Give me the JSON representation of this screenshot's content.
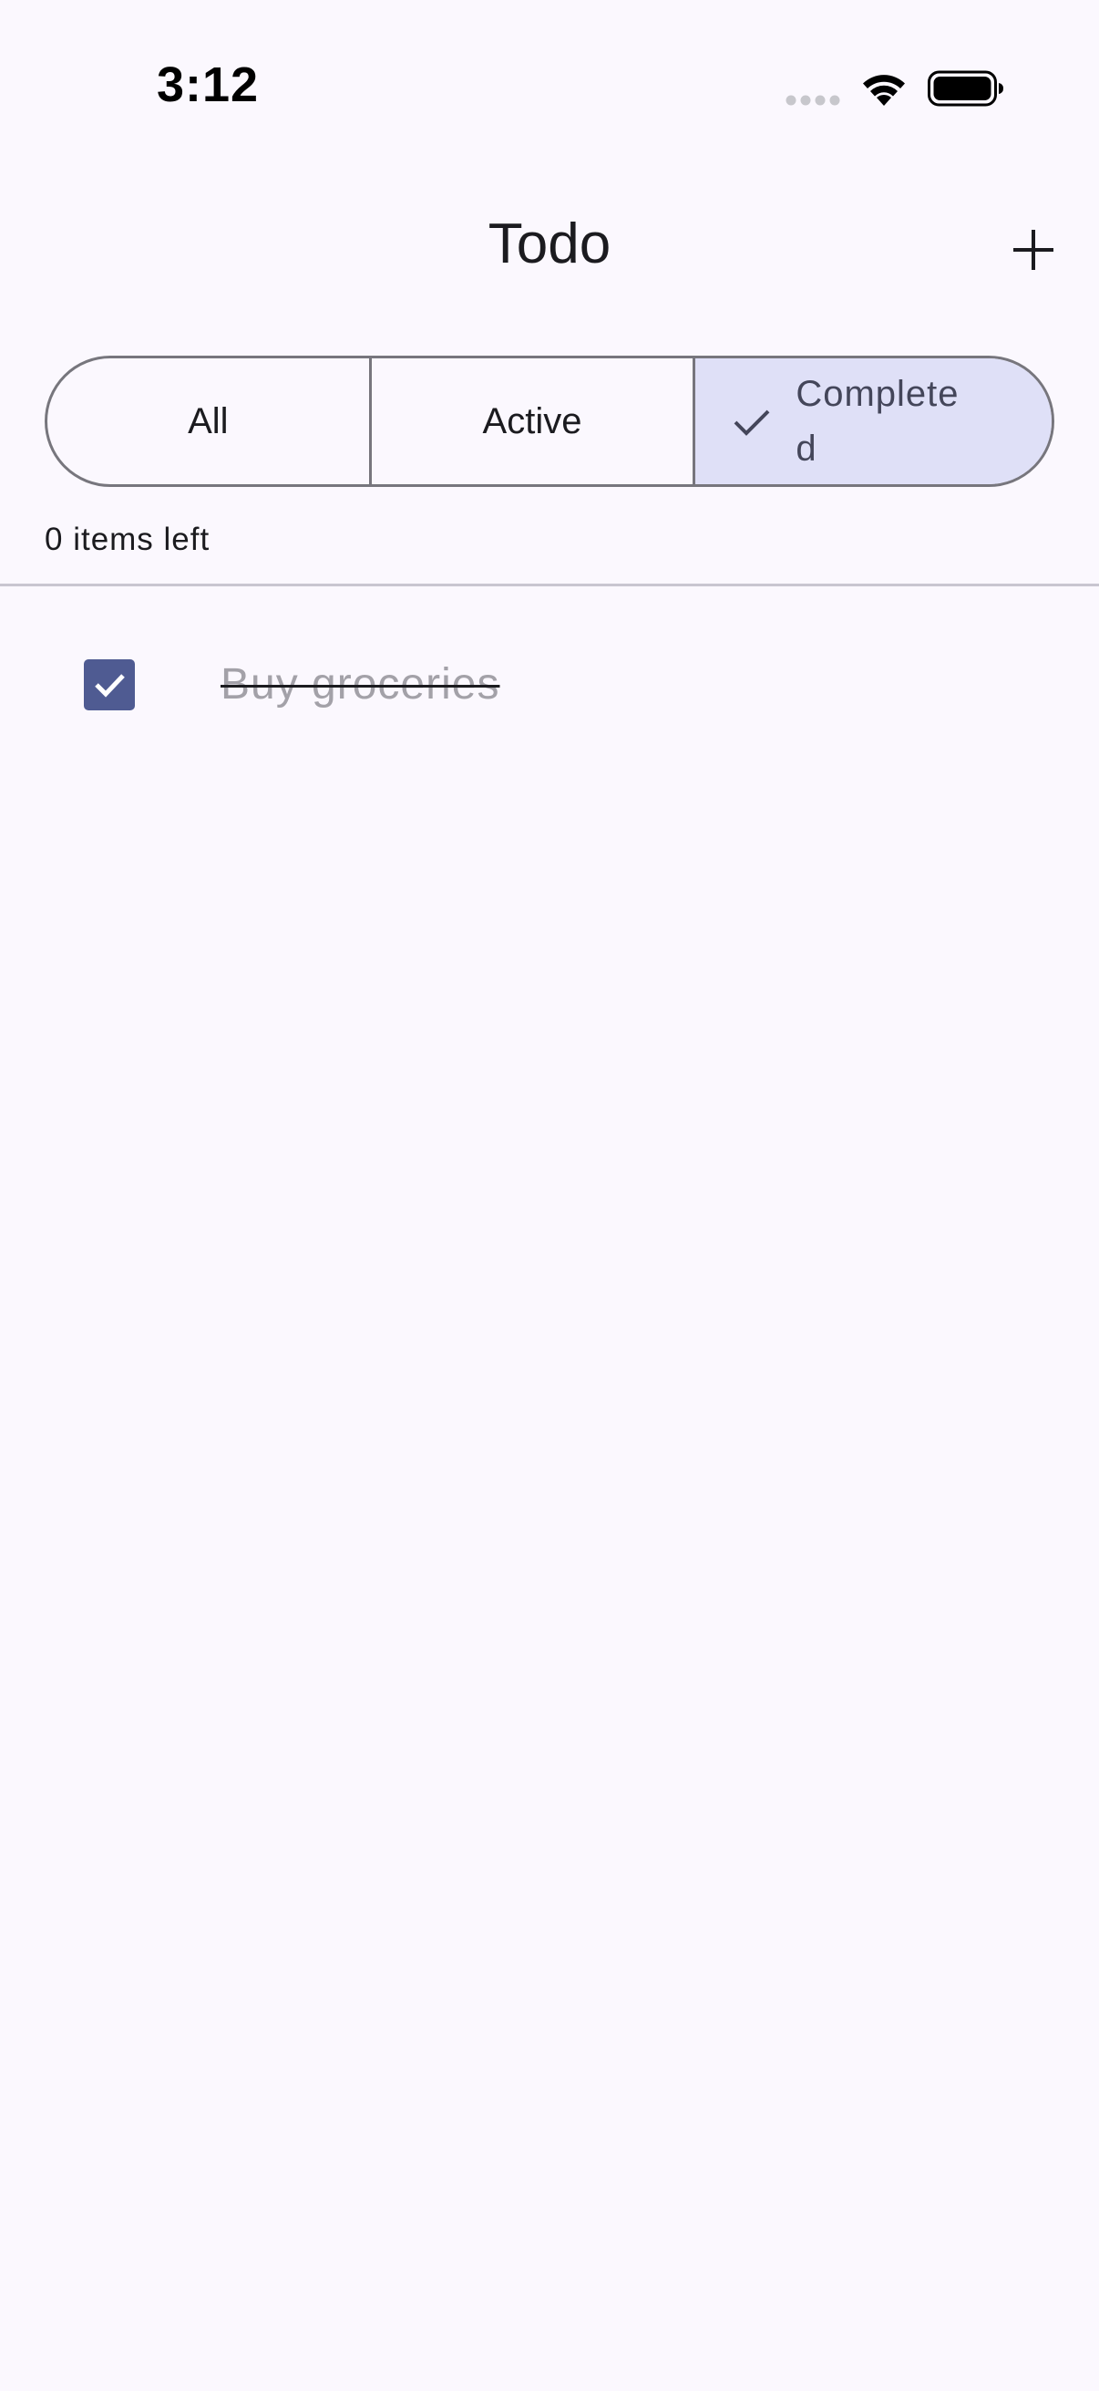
{
  "status_bar": {
    "time": "3:12",
    "icons": [
      "signal-dots-icon",
      "wifi-icon",
      "battery-icon"
    ]
  },
  "app_bar": {
    "title": "Todo",
    "add_icon": "plus-icon"
  },
  "filter": {
    "segments": [
      {
        "label": "All",
        "selected": false
      },
      {
        "label": "Active",
        "selected": false
      },
      {
        "label": "Completed",
        "selected": true
      }
    ],
    "selected_icon": "check-icon"
  },
  "summary": {
    "items_left": "0 items left"
  },
  "todos": [
    {
      "text": "Buy groceries",
      "completed": true
    }
  ],
  "colors": {
    "background": "#fbf8fe",
    "selected_segment": "#dfe0f7",
    "checkbox": "#4f5b92",
    "completed_text": "#a3a1a8",
    "outline": "#77767d",
    "divider": "#c8c5d0"
  }
}
